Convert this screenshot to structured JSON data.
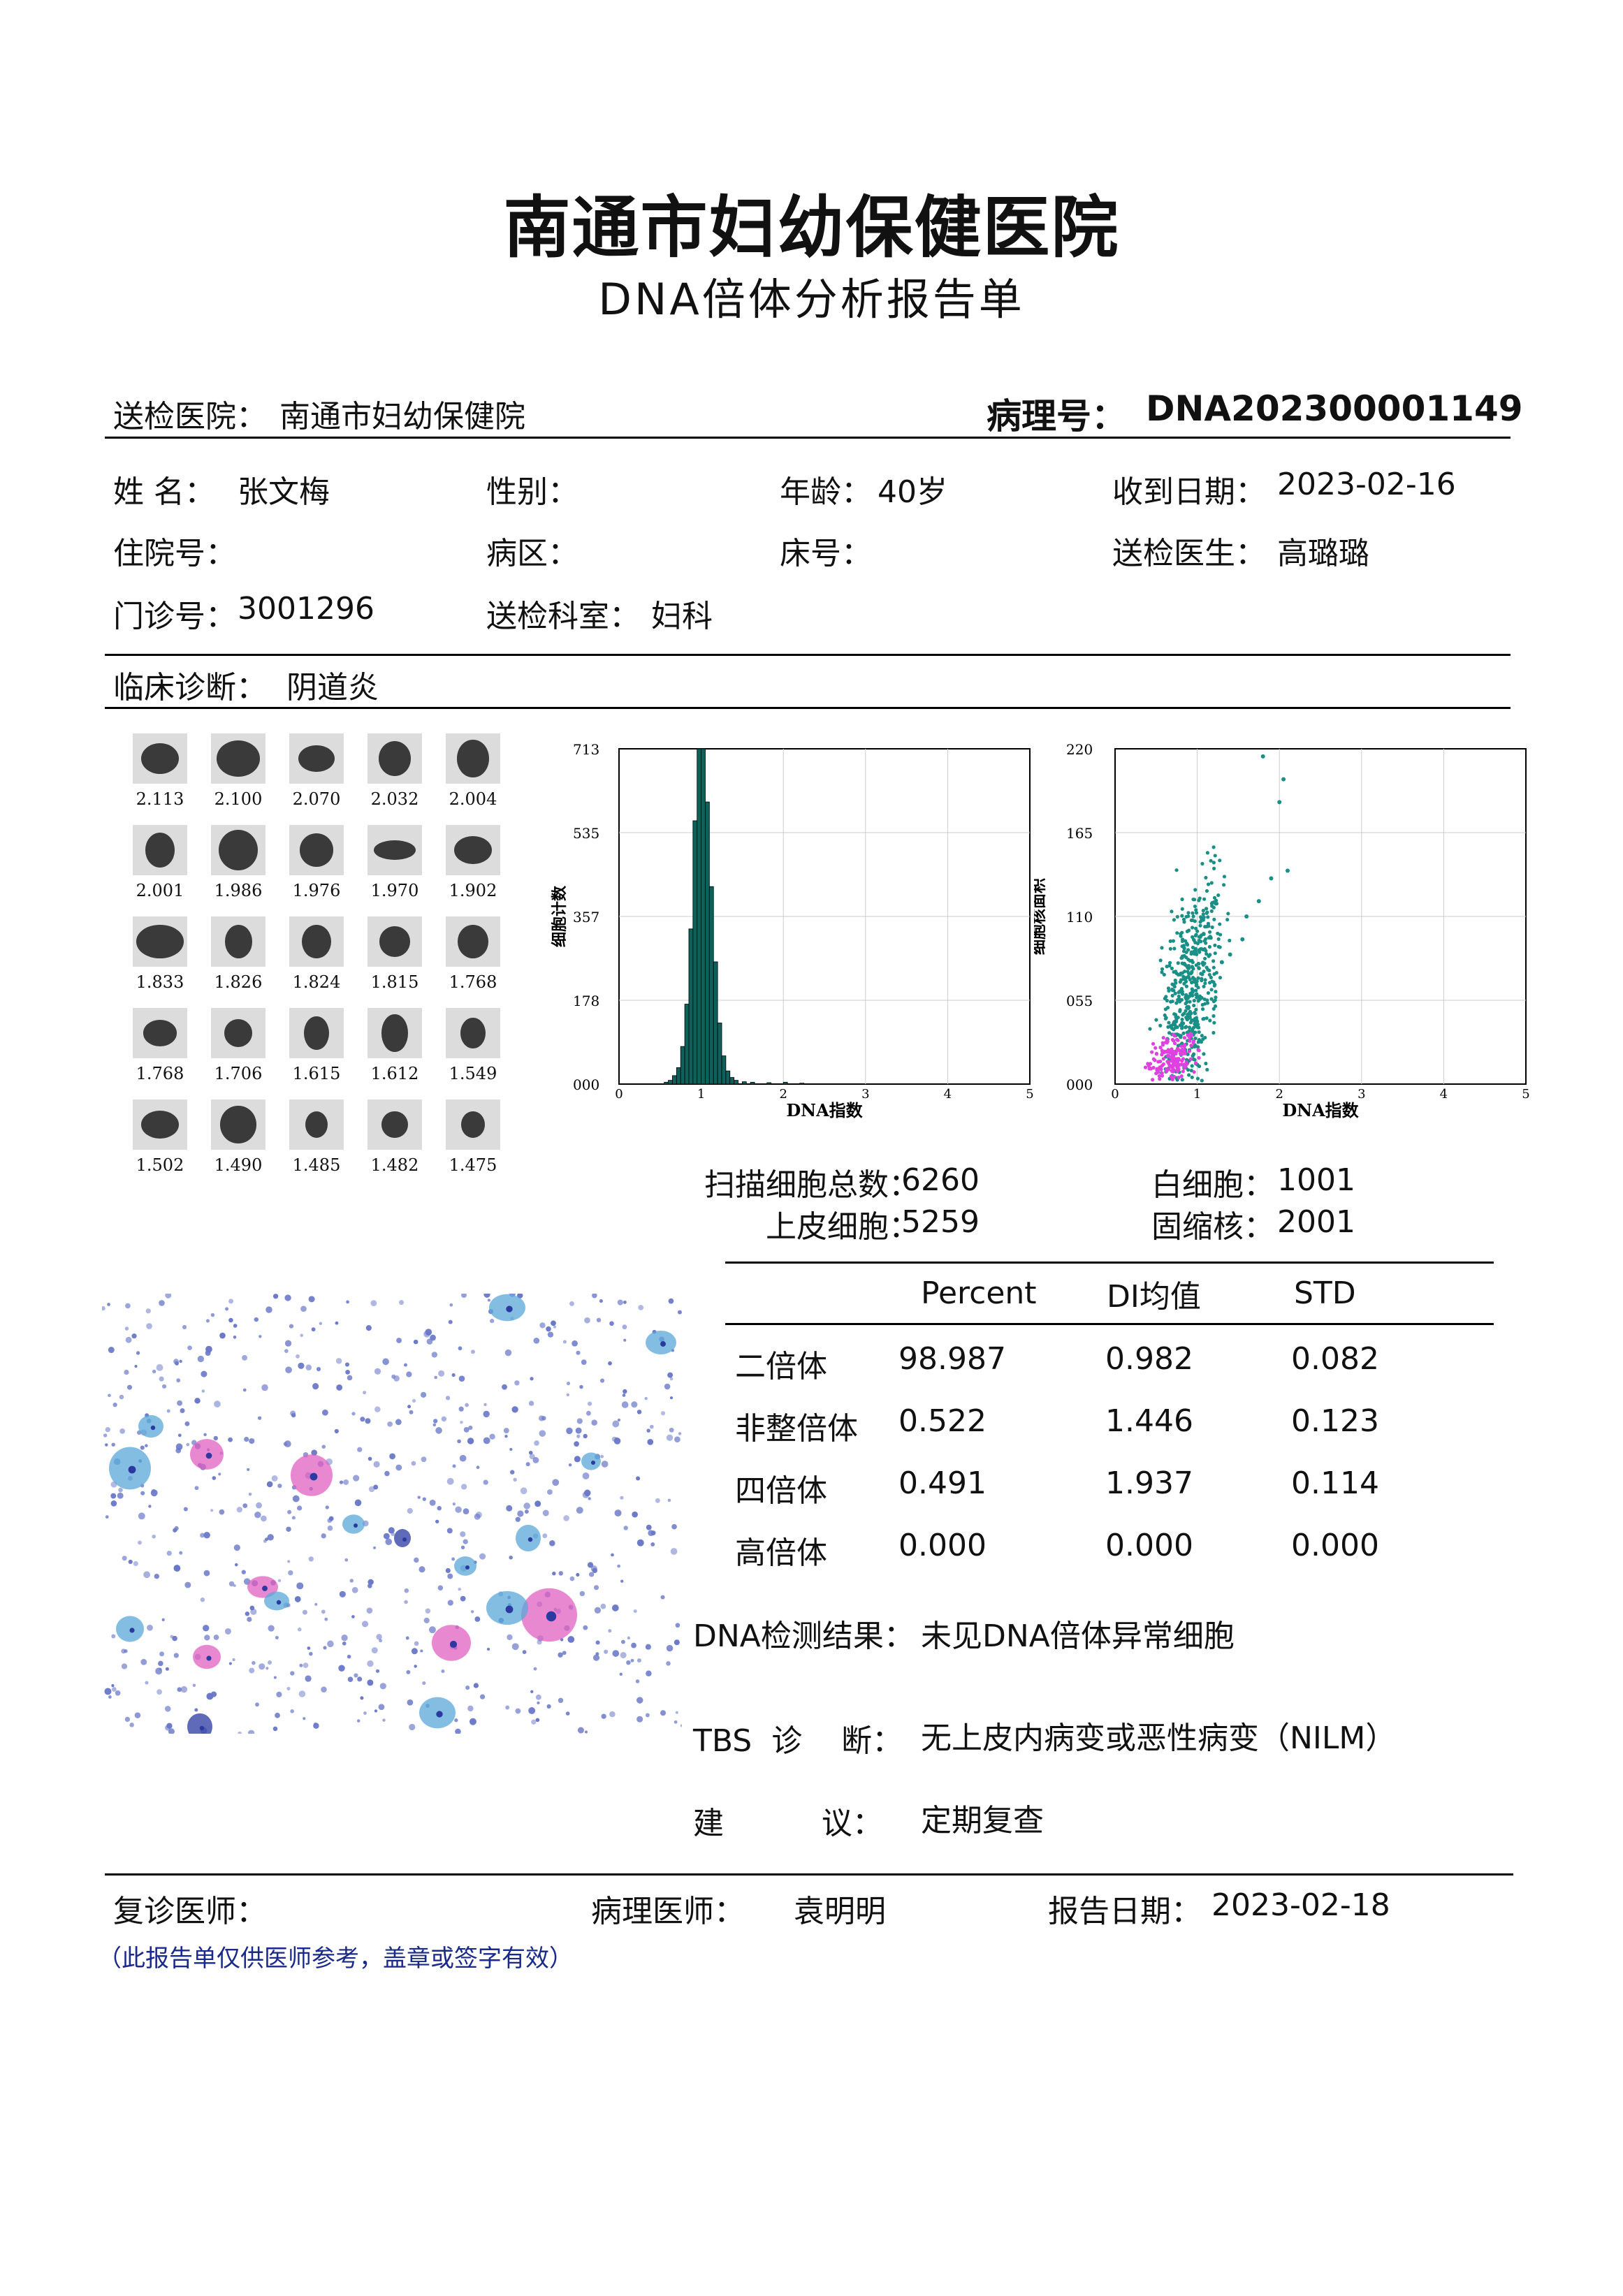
{
  "header": {
    "hospital_name": "南通市妇幼保健医院",
    "report_title": "DNA倍体分析报告单"
  },
  "submit": {
    "label": "送检医院：",
    "value": "南通市妇幼保健院",
    "pathology_label": "病理号：",
    "pathology_no": "DNA202300001149"
  },
  "patient": {
    "name_label": "姓  名：",
    "name": "张文梅",
    "sex_label": "性别：",
    "sex": "",
    "age_label": "年龄：",
    "age": "40岁",
    "received_label": "收到日期：",
    "received": "2023-02-16",
    "inpatient_label": "住院号：",
    "inpatient": "",
    "ward_label": "病区：",
    "ward": "",
    "bed_label": "床号：",
    "bed": "",
    "doctor_label": "送检医生：",
    "doctor": "高璐璐",
    "outpatient_label": "门诊号：",
    "outpatient": "3001296",
    "dept_label": "送检科室：",
    "dept": "妇科",
    "diagnosis_label": "临床诊断：",
    "diagnosis": "阴道炎"
  },
  "cells": [
    {
      "value": "2.113",
      "nw": 0.7,
      "nh": 0.62
    },
    {
      "value": "2.100",
      "nw": 0.8,
      "nh": 0.72
    },
    {
      "value": "2.070",
      "nw": 0.66,
      "nh": 0.54
    },
    {
      "value": "2.032",
      "nw": 0.6,
      "nh": 0.7
    },
    {
      "value": "2.004",
      "nw": 0.58,
      "nh": 0.74
    },
    {
      "value": "2.001",
      "nw": 0.55,
      "nh": 0.7
    },
    {
      "value": "1.986",
      "nw": 0.72,
      "nh": 0.8
    },
    {
      "value": "1.976",
      "nw": 0.62,
      "nh": 0.66
    },
    {
      "value": "1.970",
      "nw": 0.78,
      "nh": 0.4
    },
    {
      "value": "1.902",
      "nw": 0.7,
      "nh": 0.56
    },
    {
      "value": "1.833",
      "nw": 0.86,
      "nh": 0.66
    },
    {
      "value": "1.826",
      "nw": 0.5,
      "nh": 0.66
    },
    {
      "value": "1.824",
      "nw": 0.54,
      "nh": 0.68
    },
    {
      "value": "1.815",
      "nw": 0.56,
      "nh": 0.6
    },
    {
      "value": "1.768",
      "nw": 0.56,
      "nh": 0.66
    },
    {
      "value": "1.768",
      "nw": 0.62,
      "nh": 0.52
    },
    {
      "value": "1.706",
      "nw": 0.52,
      "nh": 0.56
    },
    {
      "value": "1.615",
      "nw": 0.46,
      "nh": 0.68
    },
    {
      "value": "1.612",
      "nw": 0.48,
      "nh": 0.74
    },
    {
      "value": "1.549",
      "nw": 0.46,
      "nh": 0.62
    },
    {
      "value": "1.502",
      "nw": 0.7,
      "nh": 0.56
    },
    {
      "value": "1.490",
      "nw": 0.66,
      "nh": 0.74
    },
    {
      "value": "1.485",
      "nw": 0.42,
      "nh": 0.54
    },
    {
      "value": "1.482",
      "nw": 0.48,
      "nh": 0.54
    },
    {
      "value": "1.475",
      "nw": 0.44,
      "nh": 0.54
    }
  ],
  "chart_data": [
    {
      "type": "bar",
      "xlabel": "DNA指数",
      "ylabel": "细胞计数",
      "xticks": [
        "0",
        "1",
        "2",
        "3",
        "4",
        "5"
      ],
      "yticks": [
        "000",
        "178",
        "357",
        "535",
        "713"
      ],
      "xlim": [
        0,
        5
      ],
      "ylim": [
        0,
        713
      ],
      "bin_width": 0.05,
      "x": [
        0.55,
        0.6,
        0.65,
        0.7,
        0.75,
        0.8,
        0.85,
        0.9,
        0.95,
        1.0,
        1.05,
        1.1,
        1.15,
        1.2,
        1.25,
        1.3,
        1.35,
        1.4,
        1.5,
        1.6,
        1.8,
        2.0,
        2.2
      ],
      "values": [
        4,
        8,
        18,
        35,
        80,
        170,
        330,
        560,
        713,
        713,
        600,
        420,
        260,
        130,
        60,
        28,
        14,
        8,
        5,
        4,
        3,
        4,
        2
      ],
      "color": "#0f5f5a"
    },
    {
      "type": "scatter",
      "xlabel": "DNA指数",
      "ylabel": "细胞核面积",
      "xticks": [
        "0",
        "1",
        "2",
        "3",
        "4",
        "5"
      ],
      "yticks": [
        "000",
        "055",
        "110",
        "165",
        "220"
      ],
      "xlim": [
        0,
        5
      ],
      "ylim": [
        0,
        220
      ],
      "series": [
        {
          "color": "#1a8f86",
          "x_center": 0.95,
          "x_spread": 0.18,
          "y_center": 65,
          "y_spread": 30
        },
        {
          "color": "#e040e0",
          "x_center": 0.7,
          "x_spread": 0.14,
          "y_center": 18,
          "y_spread": 7
        }
      ],
      "outliers": [
        [
          1.8,
          215
        ],
        [
          2.05,
          200
        ],
        [
          2.0,
          185
        ],
        [
          2.1,
          140
        ],
        [
          1.9,
          135
        ],
        [
          1.75,
          120
        ],
        [
          1.6,
          110
        ],
        [
          1.55,
          95
        ],
        [
          1.4,
          85
        ],
        [
          1.3,
          80
        ]
      ]
    }
  ],
  "counts": {
    "total_label": "扫描细胞总数：",
    "total": "6260",
    "wbc_label": "白细胞：",
    "wbc": "1001",
    "epi_label": "上皮细胞：",
    "epi": "5259",
    "pyk_label": "固缩核：",
    "pyk": "2001"
  },
  "ploidy_table": {
    "headers": [
      "Percent",
      "DI均值",
      "STD"
    ],
    "rows": [
      {
        "name": "二倍体",
        "percent": "98.987",
        "di": "0.982",
        "std": "0.082"
      },
      {
        "name": "非整倍体",
        "percent": "0.522",
        "di": "1.446",
        "std": "0.123"
      },
      {
        "name": "四倍体",
        "percent": "0.491",
        "di": "1.937",
        "std": "0.114"
      },
      {
        "name": "高倍体",
        "percent": "0.000",
        "di": "0.000",
        "std": "0.000"
      }
    ]
  },
  "results": {
    "dna_label": "DNA检测结果：",
    "dna_value": "未见DNA倍体异常细胞",
    "tbs_label": "TBS  诊    断：",
    "tbs_value": "无上皮内病变或恶性病变（NILM）",
    "advice_label": "建          议：",
    "advice_value": "定期复查"
  },
  "footer": {
    "review_label": "复诊医师：",
    "review": "",
    "pathologist_label": "病理医师：",
    "pathologist": "袁明明",
    "report_date_label": "报告日期：",
    "report_date": "2023-02-18",
    "note": "（此报告单仅供医师参考，盖章或签字有效）"
  },
  "micrograph": {
    "colors": {
      "blue": "#5aa8d8",
      "pink": "#e060c0",
      "dot": "#6a78c8",
      "dark": "#2a3aa0"
    }
  }
}
